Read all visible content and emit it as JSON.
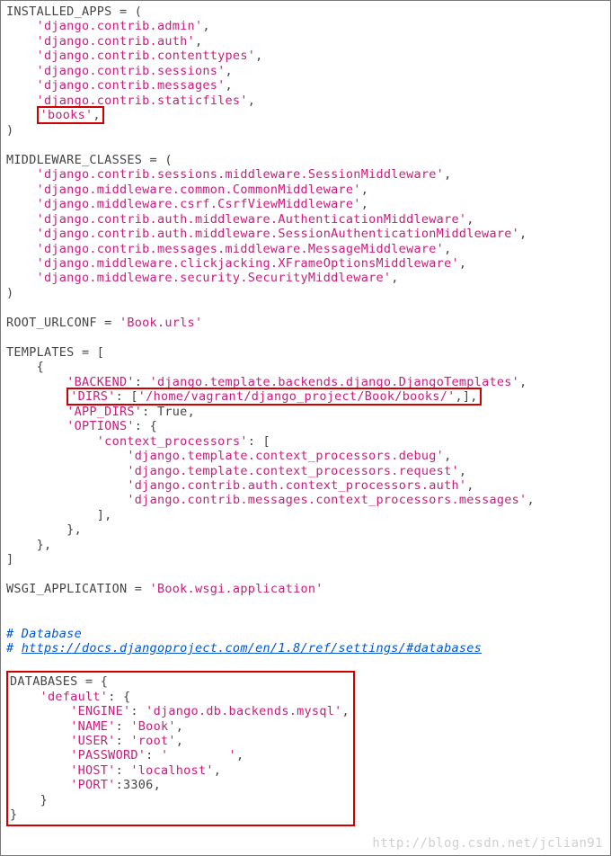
{
  "code": {
    "installed_apps_head": "INSTALLED_APPS = (",
    "installed_apps": [
      "'django.contrib.admin'",
      "'django.contrib.auth'",
      "'django.contrib.contenttypes'",
      "'django.contrib.sessions'",
      "'django.contrib.messages'",
      "'django.contrib.staticfiles'"
    ],
    "installed_apps_boxed": "'books'",
    "close_paren": ")",
    "middleware_head": "MIDDLEWARE_CLASSES = (",
    "middleware": [
      "'django.contrib.sessions.middleware.SessionMiddleware'",
      "'django.middleware.common.CommonMiddleware'",
      "'django.middleware.csrf.CsrfViewMiddleware'",
      "'django.contrib.auth.middleware.AuthenticationMiddleware'",
      "'django.contrib.auth.middleware.SessionAuthenticationMiddleware'",
      "'django.contrib.messages.middleware.MessageMiddleware'",
      "'django.middleware.clickjacking.XFrameOptionsMiddleware'",
      "'django.middleware.security.SecurityMiddleware'"
    ],
    "root_urlconf_k": "ROOT_URLCONF = ",
    "root_urlconf_v": "'Book.urls'",
    "templates_head": "TEMPLATES = [",
    "templates_open": "    {",
    "backend_k": "'BACKEND'",
    "backend_v": "'django.template.backends.django.DjangoTemplates'",
    "dirs_k": "'DIRS'",
    "dirs_v": "'/home/vagrant/django_project/Book/books/'",
    "app_dirs_k": "'APP_DIRS'",
    "app_dirs_v": "True",
    "options_k": "'OPTIONS'",
    "context_k": "'context_processors'",
    "context_items": [
      "'django.template.context_processors.debug'",
      "'django.template.context_processors.request'",
      "'django.contrib.auth.context_processors.auth'",
      "'django.contrib.messages.context_processors.messages'"
    ],
    "templates_close_list": "            ],",
    "templates_close_opt": "        },",
    "templates_close_obj": "    },",
    "templates_close": "]",
    "wsgi_k": "WSGI_APPLICATION = ",
    "wsgi_v": "'Book.wsgi.application'",
    "comment_db": "# Database",
    "comment_url_prefix": "# ",
    "comment_url": "https://docs.djangoproject.com/en/1.8/ref/settings/#databases",
    "db_head": "DATABASES = {",
    "db_default_k": "'default'",
    "db_engine_k": "'ENGINE'",
    "db_engine_v": "'django.db.backends.mysql'",
    "db_name_k": "'NAME'",
    "db_name_v": "'Book'",
    "db_user_k": "'USER'",
    "db_user_v": "'root'",
    "db_pass_k": "'PASSWORD'",
    "db_pass_v": "'        '",
    "db_host_k": "'HOST'",
    "db_host_v": "'localhost'",
    "db_port_k": "'PORT'",
    "db_port_v": "3306",
    "db_close_inner": "    }",
    "db_close": "}"
  },
  "watermark": "http://blog.csdn.net/jclian91"
}
